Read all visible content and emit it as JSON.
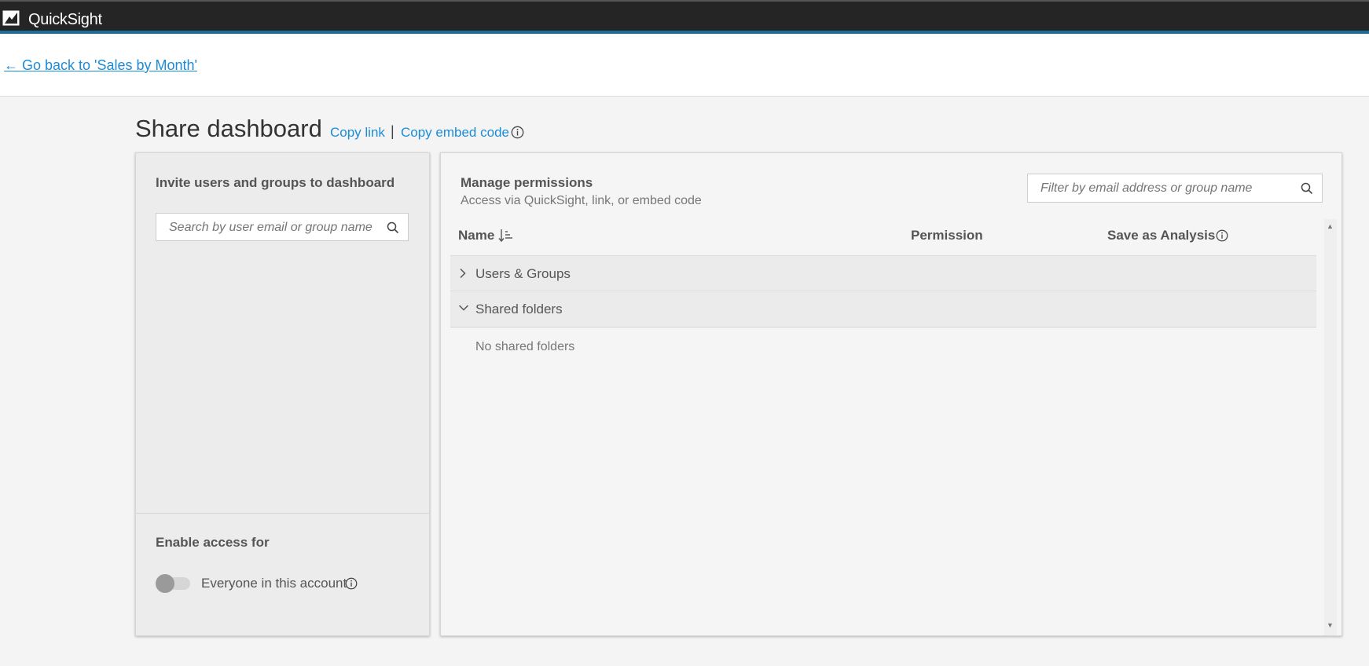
{
  "app": {
    "title": "QuickSight"
  },
  "nav": {
    "back_link": "← Go back to 'Sales by Month'"
  },
  "page": {
    "title": "Share dashboard",
    "copy_link": "Copy link",
    "separator": "|",
    "copy_embed": "Copy embed code"
  },
  "invite": {
    "title": "Invite users and groups to dashboard",
    "search_placeholder": "Search by user email or group name"
  },
  "access": {
    "title": "Enable access for",
    "everyone_label": "Everyone in this account",
    "everyone_enabled": false
  },
  "permissions": {
    "title": "Manage permissions",
    "subtitle": "Access via QuickSight, link, or embed code",
    "filter_placeholder": "Filter by email address or group name",
    "columns": {
      "name": "Name",
      "permission": "Permission",
      "save_as_analysis": "Save as Analysis"
    },
    "rows": [
      {
        "label": "Users & Groups",
        "expanded": false
      },
      {
        "label": "Shared folders",
        "expanded": true
      }
    ],
    "empty_shared": "No shared folders"
  },
  "colors": {
    "link": "#1a8cd8",
    "header_bg": "#252525",
    "header_accent": "#1b6e99"
  }
}
